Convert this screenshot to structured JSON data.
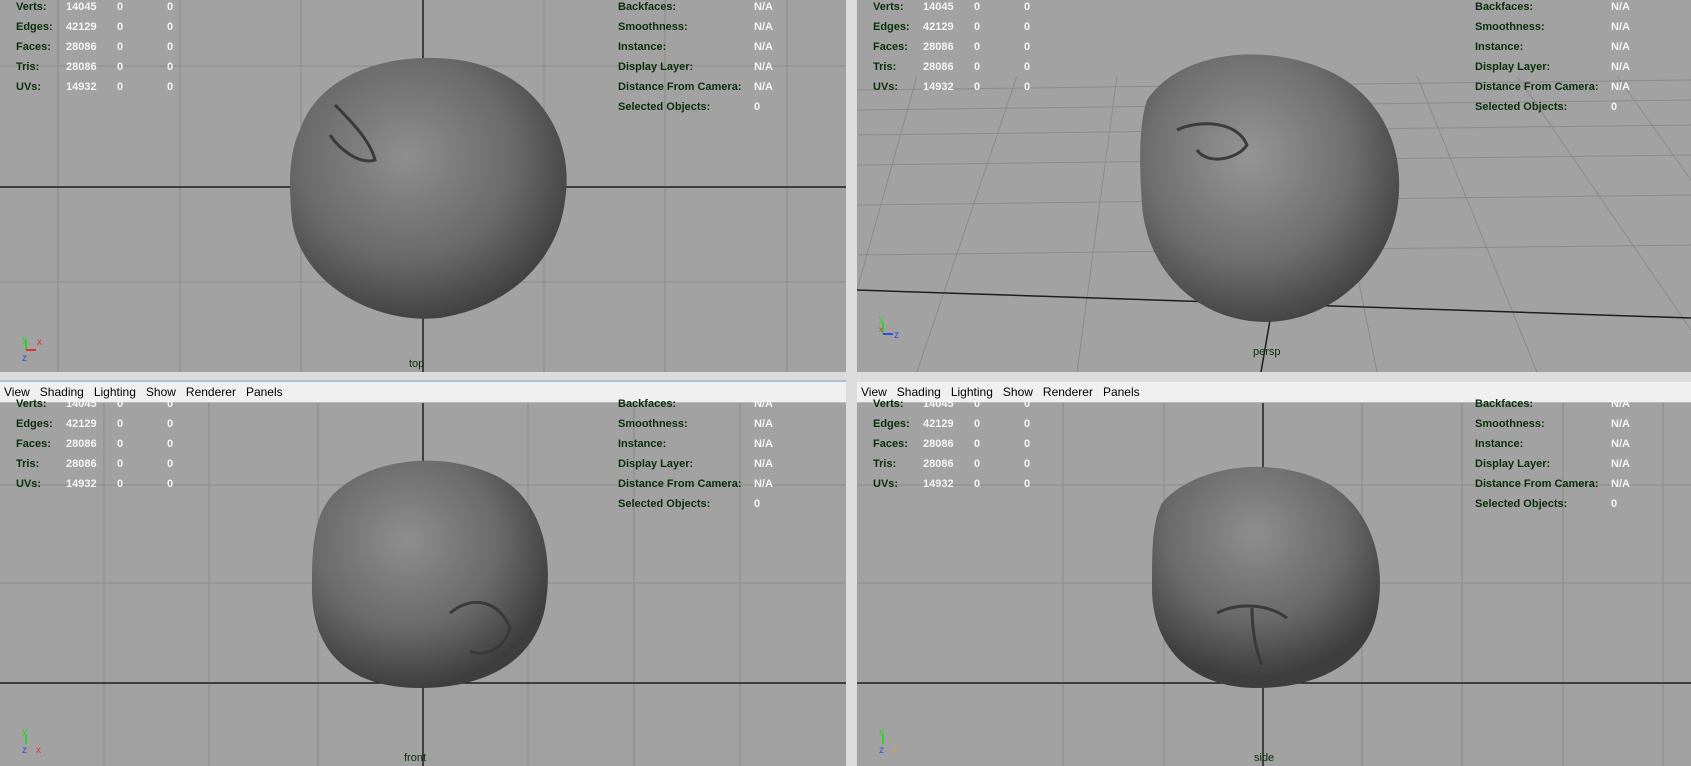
{
  "menu": [
    "View",
    "Shading",
    "Lighting",
    "Show",
    "Renderer",
    "Panels"
  ],
  "hud_left": [
    {
      "label": "Verts:",
      "values": [
        "14045",
        "0",
        "0"
      ]
    },
    {
      "label": "Edges:",
      "values": [
        "42129",
        "0",
        "0"
      ]
    },
    {
      "label": "Faces:",
      "values": [
        "28086",
        "0",
        "0"
      ]
    },
    {
      "label": "Tris:",
      "values": [
        "28086",
        "0",
        "0"
      ]
    },
    {
      "label": "UVs:",
      "values": [
        "14932",
        "0",
        "0"
      ]
    }
  ],
  "hud_right": [
    {
      "label": "Backfaces:",
      "value": "N/A"
    },
    {
      "label": "Smoothness:",
      "value": "N/A"
    },
    {
      "label": "Instance:",
      "value": "N/A"
    },
    {
      "label": "Display Layer:",
      "value": "N/A"
    },
    {
      "label": "Distance From Camera:",
      "value": "N/A"
    },
    {
      "label": "Selected Objects:",
      "value": "0"
    }
  ],
  "viewports": {
    "top": {
      "camera": "top",
      "axes": [
        "y",
        "x",
        "z"
      ]
    },
    "persp": {
      "camera": "persp",
      "axes": [
        "y",
        "x",
        "z"
      ]
    },
    "front": {
      "camera": "front",
      "axes": [
        "y",
        "z",
        "x"
      ]
    },
    "side": {
      "camera": "side",
      "axes": [
        "y",
        "z",
        "x"
      ]
    }
  },
  "colors": {
    "viewport_bg": "#a2a2a2",
    "hud_label": "#0a2f0a",
    "hud_value": "#f4f4f4",
    "axis_y": "#2ed12e",
    "axis_x": "#e03030",
    "axis_z": "#2a4ee0"
  }
}
